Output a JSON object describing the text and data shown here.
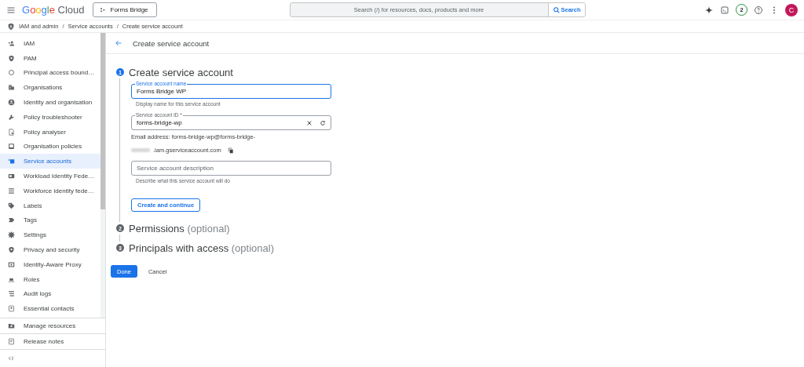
{
  "topbar": {
    "logo": {
      "brand": "Google",
      "product": "Cloud"
    },
    "project": "Forms Bridge",
    "search": {
      "placeholder": "Search (/) for resources, docs, products and more",
      "button": "Search"
    },
    "notifications": "2",
    "avatar": "C"
  },
  "breadcrumb": {
    "separator": "/",
    "items": [
      "IAM and admin",
      "Service accounts",
      "Create service account"
    ]
  },
  "sidebar": {
    "items": [
      {
        "label": "IAM",
        "selected": false
      },
      {
        "label": "PAM",
        "selected": false
      },
      {
        "label": "Principal access bound…",
        "selected": false
      },
      {
        "label": "Organisations",
        "selected": false
      },
      {
        "label": "Identity and organisation",
        "selected": false
      },
      {
        "label": "Policy troubleshooter",
        "selected": false
      },
      {
        "label": "Policy analyser",
        "selected": false
      },
      {
        "label": "Organisation policies",
        "selected": false
      },
      {
        "label": "Service accounts",
        "selected": true
      },
      {
        "label": "Workload Identity Fede…",
        "selected": false
      },
      {
        "label": "Workforce identity fede…",
        "selected": false
      },
      {
        "label": "Labels",
        "selected": false
      },
      {
        "label": "Tags",
        "selected": false
      },
      {
        "label": "Settings",
        "selected": false
      },
      {
        "label": "Privacy and security",
        "selected": false
      },
      {
        "label": "Identity-Aware Proxy",
        "selected": false
      },
      {
        "label": "Roles",
        "selected": false
      },
      {
        "label": "Audit logs",
        "selected": false
      },
      {
        "label": "Essential contacts",
        "selected": false
      }
    ],
    "footer": [
      "Manage resources",
      "Release notes"
    ]
  },
  "page": {
    "title": "Create service account",
    "steps": [
      {
        "number": "1",
        "title": "Create service account",
        "selected": true
      },
      {
        "number": "2",
        "title": "Permissions",
        "optional": "(optional)",
        "selected": false
      },
      {
        "number": "3",
        "title": "Principals with access",
        "optional": "(optional)",
        "selected": false
      }
    ],
    "form": {
      "name_field": {
        "label": "Service account name",
        "value": "Forms Bridge WP",
        "hint": "Display name for this service account",
        "focused": true
      },
      "id_field": {
        "label": "Service account ID *",
        "value": "forms-bridge-wp",
        "focused": false
      },
      "email": {
        "line1": "Email address: forms-bridge-wp@forms-bridge-",
        "line2": ".iam.gserviceaccount.com"
      },
      "description_field": {
        "placeholder": "Service account description",
        "hint": "Describe what this service account will do"
      },
      "continue_button": "Create and continue"
    },
    "buttons": {
      "done": "Done",
      "cancel": "Cancel"
    }
  }
}
